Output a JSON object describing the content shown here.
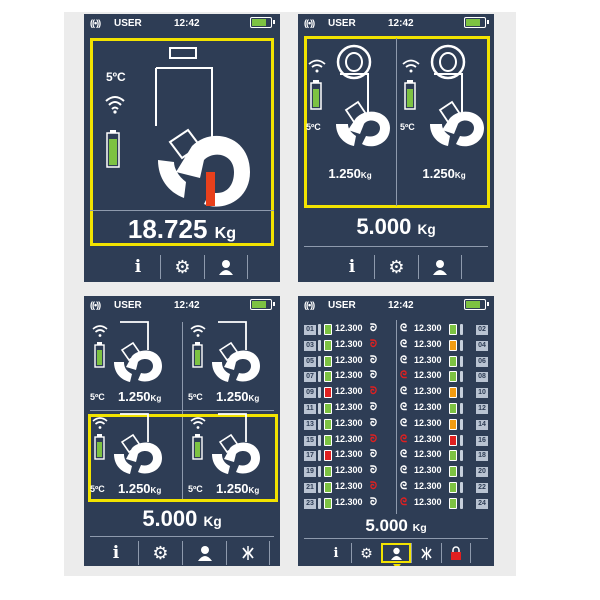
{
  "status": {
    "signal": "((•))",
    "user": "USER",
    "time": "12:42"
  },
  "screen1": {
    "temp": "5ºC",
    "weight": "18.725",
    "unit": "Kg"
  },
  "screen2": {
    "temp_left": "5ºC",
    "temp_right": "5ºC",
    "cell_left": "1.250",
    "cell_right": "1.250",
    "cell_unit": "Kg",
    "total": "5.000",
    "unit": "Kg"
  },
  "screen3": {
    "cells": [
      {
        "temp": "5ºC",
        "weight": "1.250",
        "unit": "Kg"
      },
      {
        "temp": "5ºC",
        "weight": "1.250",
        "unit": "Kg"
      },
      {
        "temp": "5ºC",
        "weight": "1.250",
        "unit": "Kg"
      },
      {
        "temp": "5ºC",
        "weight": "1.250",
        "unit": "Kg"
      }
    ],
    "total": "5.000",
    "unit": "Kg"
  },
  "screen4": {
    "rows": [
      {
        "left_id": "01",
        "left_val": "12.300",
        "right_val": "12.300",
        "right_id": "02",
        "left_batt": "#7dc242",
        "right_batt": "#7dc242"
      },
      {
        "left_id": "03",
        "left_val": "12.300",
        "right_val": "12.300",
        "right_id": "04",
        "left_batt": "#7dc242",
        "right_batt": "#f39c12"
      },
      {
        "left_id": "05",
        "left_val": "12.300",
        "right_val": "12.300",
        "right_id": "06",
        "left_batt": "#7dc242",
        "right_batt": "#7dc242"
      },
      {
        "left_id": "07",
        "left_val": "12.300",
        "right_val": "12.300",
        "right_id": "08",
        "left_batt": "#7dc242",
        "right_batt": "#7dc242"
      },
      {
        "left_id": "09",
        "left_val": "12.300",
        "right_val": "12.300",
        "right_id": "10",
        "left_batt": "#e02020",
        "right_batt": "#f39c12"
      },
      {
        "left_id": "11",
        "left_val": "12.300",
        "right_val": "12.300",
        "right_id": "12",
        "left_batt": "#7dc242",
        "right_batt": "#7dc242"
      },
      {
        "left_id": "13",
        "left_val": "12.300",
        "right_val": "12.300",
        "right_id": "14",
        "left_batt": "#7dc242",
        "right_batt": "#f39c12"
      },
      {
        "left_id": "15",
        "left_val": "12.300",
        "right_val": "12.300",
        "right_id": "16",
        "left_batt": "#7dc242",
        "right_batt": "#e02020"
      },
      {
        "left_id": "17",
        "left_val": "12.300",
        "right_val": "12.300",
        "right_id": "18",
        "left_batt": "#e02020",
        "right_batt": "#7dc242"
      },
      {
        "left_id": "19",
        "left_val": "12.300",
        "right_val": "12.300",
        "right_id": "20",
        "left_batt": "#7dc242",
        "right_batt": "#7dc242"
      },
      {
        "left_id": "21",
        "left_val": "12.300",
        "right_val": "12.300",
        "right_id": "22",
        "left_batt": "#7dc242",
        "right_batt": "#7dc242"
      },
      {
        "left_id": "23",
        "left_val": "12.300",
        "right_val": "12.300",
        "right_id": "24",
        "left_batt": "#7dc242",
        "right_batt": "#7dc242"
      }
    ],
    "total": "5.000",
    "unit": "Kg"
  },
  "colors": {
    "background": "#2e3d55",
    "highlight": "#f2e300",
    "battery_ok": "#7dc242",
    "battery_low": "#f39c12",
    "battery_critical": "#e02020",
    "load_pin": "#e8401c"
  },
  "nav_icons": [
    "info-icon",
    "gear-icon",
    "user-icon",
    "scale-icon",
    "lock-icon"
  ]
}
